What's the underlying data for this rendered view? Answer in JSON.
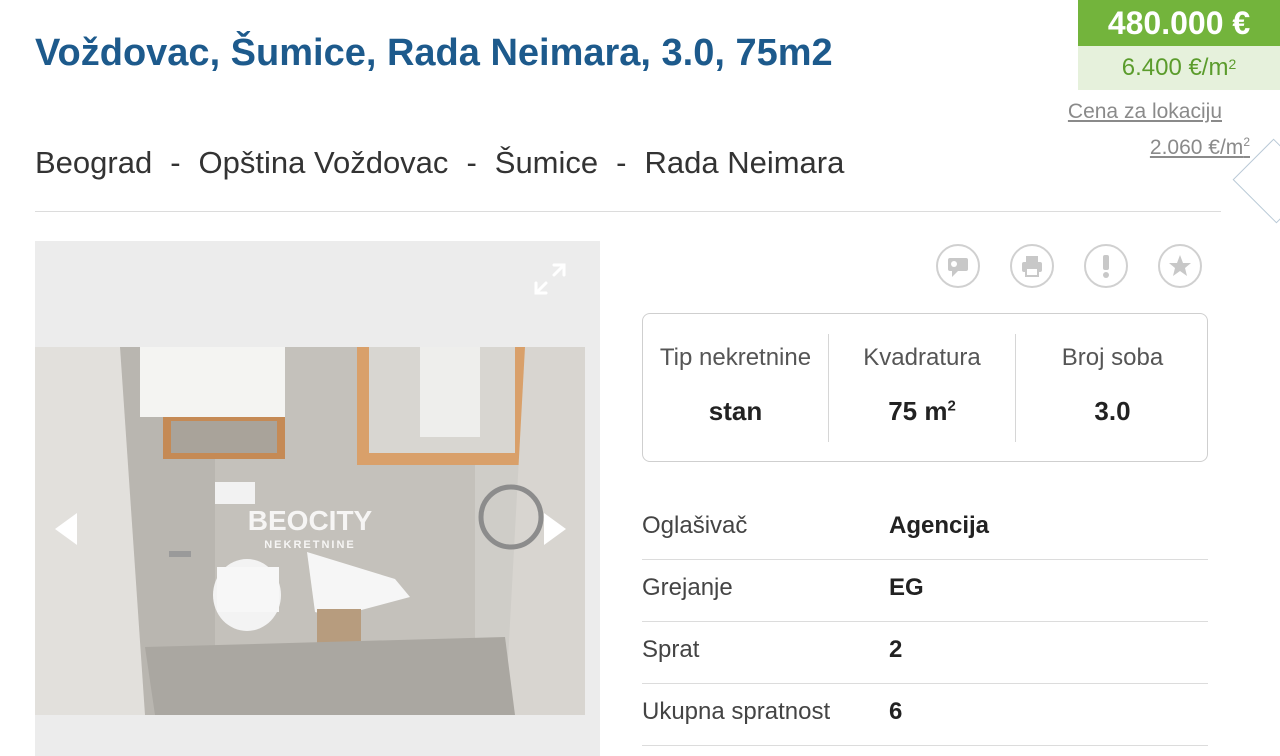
{
  "listing": {
    "title": "Voždovac, Šumice, Rada Neimara, 3.0, 75m2",
    "breadcrumb": [
      "Beograd",
      "Opština Voždovac",
      "Šumice",
      "Rada Neimara"
    ],
    "breadcrumb_separator": "-"
  },
  "price": {
    "total": "480.000 €",
    "per_m2": "6.400 €/m",
    "per_m2_exp": "2",
    "location_label": "Cena za lokaciju",
    "location_value": "2.060 €/m",
    "location_value_exp": "2"
  },
  "gallery": {
    "watermark_main": "BEOCITY",
    "watermark_sub": "NEKRETNINE",
    "icons": [
      "expand-icon",
      "arrow-left-icon",
      "arrow-right-icon"
    ]
  },
  "actions": [
    "message-icon",
    "print-icon",
    "report-icon",
    "favorite-star-icon"
  ],
  "summary": [
    {
      "label": "Tip nekretnine",
      "value": "stan",
      "sup": ""
    },
    {
      "label": "Kvadratura",
      "value": "75 m",
      "sup": "2"
    },
    {
      "label": "Broj soba",
      "value": "3.0",
      "sup": ""
    }
  ],
  "details": [
    {
      "key": "Oglašivač",
      "value": "Agencija"
    },
    {
      "key": "Grejanje",
      "value": "EG"
    },
    {
      "key": "Sprat",
      "value": "2"
    },
    {
      "key": "Ukupna spratnost",
      "value": "6"
    }
  ],
  "colors": {
    "title": "#1d5a8c",
    "price_bg": "#73b43c",
    "price_m2_bg": "#e6f1dc",
    "price_m2_text": "#5b9c2c"
  }
}
